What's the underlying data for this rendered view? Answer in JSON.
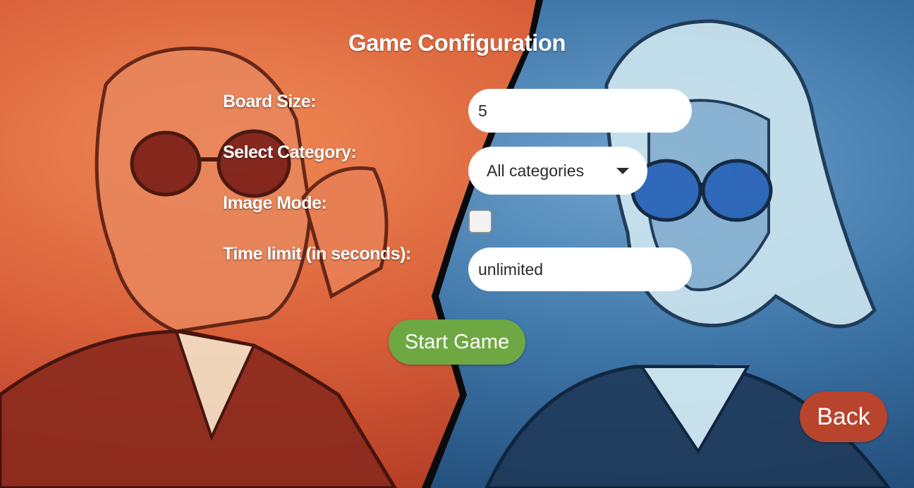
{
  "screen": {
    "title": "Game Configuration"
  },
  "form": {
    "board_size": {
      "label": "Board Size:",
      "value": "5"
    },
    "category": {
      "label": "Select Category:",
      "selected": "All categories"
    },
    "image_mode": {
      "label": "Image Mode:",
      "checked": false
    },
    "time_limit": {
      "label": "Time limit (in seconds):",
      "value": "unlimited"
    }
  },
  "buttons": {
    "start": "Start Game",
    "back": "Back"
  },
  "colors": {
    "start_button": "#6ea843",
    "back_button": "#b9442d",
    "left_side": "#d9603a",
    "right_side": "#3e76a8"
  }
}
